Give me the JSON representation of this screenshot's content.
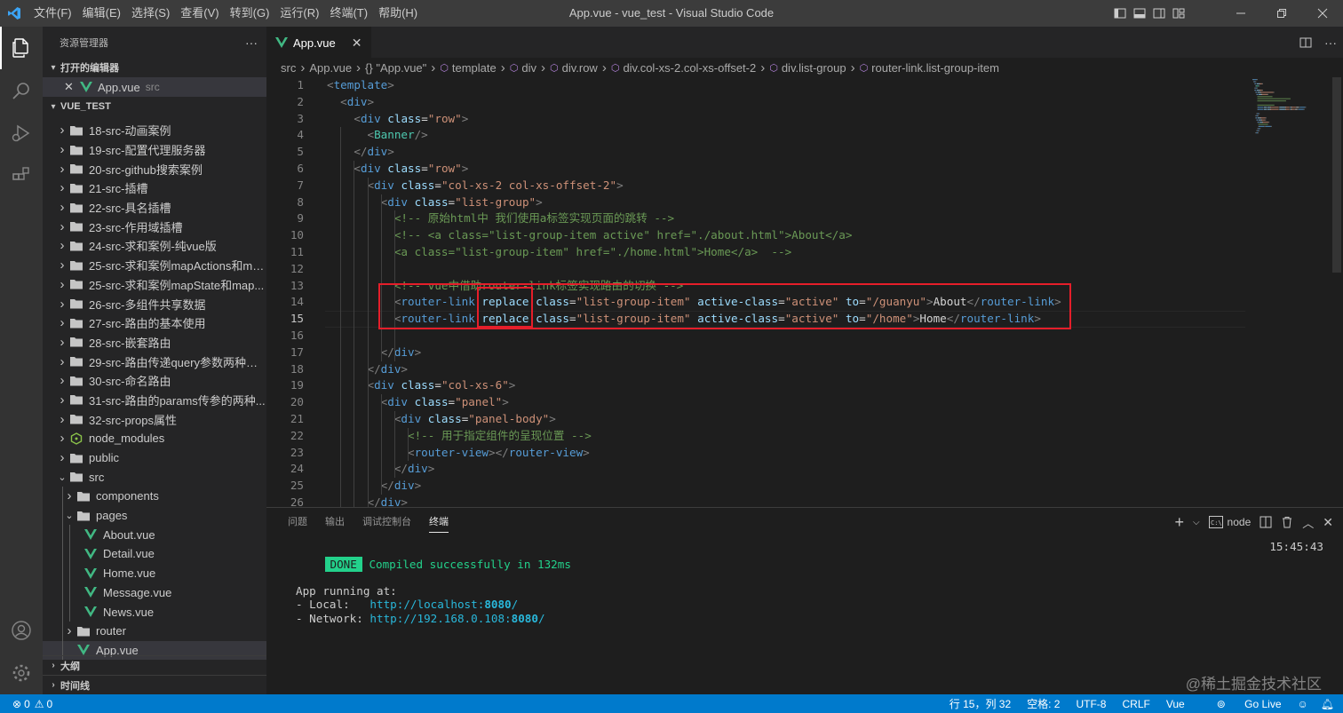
{
  "titlebar": {
    "menus": [
      "文件(F)",
      "编辑(E)",
      "选择(S)",
      "查看(V)",
      "转到(G)",
      "运行(R)",
      "终端(T)",
      "帮助(H)"
    ],
    "title": "App.vue - vue_test - Visual Studio Code"
  },
  "sidebar": {
    "header": "资源管理器",
    "more": "···",
    "open_editors_title": "打开的编辑器",
    "open_editor": {
      "name": "App.vue",
      "dir": "src"
    },
    "workspace_title": "VUE_TEST",
    "tree": [
      {
        "name": "18-src-动画案例",
        "depth": 0,
        "type": "folder",
        "open": false
      },
      {
        "name": "19-src-配置代理服务器",
        "depth": 0,
        "type": "folder",
        "open": false
      },
      {
        "name": "20-src-github搜索案例",
        "depth": 0,
        "type": "folder",
        "open": false
      },
      {
        "name": "21-src-插槽",
        "depth": 0,
        "type": "folder",
        "open": false
      },
      {
        "name": "22-src-具名插槽",
        "depth": 0,
        "type": "folder",
        "open": false
      },
      {
        "name": "23-src-作用域插槽",
        "depth": 0,
        "type": "folder",
        "open": false
      },
      {
        "name": "24-src-求和案例-纯vue版",
        "depth": 0,
        "type": "folder",
        "open": false
      },
      {
        "name": "25-src-求和案例mapActions和ma...",
        "depth": 0,
        "type": "folder",
        "open": false
      },
      {
        "name": "25-src-求和案例mapState和map...",
        "depth": 0,
        "type": "folder",
        "open": false
      },
      {
        "name": "26-src-多组件共享数据",
        "depth": 0,
        "type": "folder",
        "open": false
      },
      {
        "name": "27-src-路由的基本使用",
        "depth": 0,
        "type": "folder",
        "open": false
      },
      {
        "name": "28-src-嵌套路由",
        "depth": 0,
        "type": "folder",
        "open": false
      },
      {
        "name": "29-src-路由传递query参数两种方...",
        "depth": 0,
        "type": "folder",
        "open": false
      },
      {
        "name": "30-src-命名路由",
        "depth": 0,
        "type": "folder",
        "open": false
      },
      {
        "name": "31-src-路由的params传参的两种...",
        "depth": 0,
        "type": "folder",
        "open": false
      },
      {
        "name": "32-src-props属性",
        "depth": 0,
        "type": "folder",
        "open": false
      },
      {
        "name": "node_modules",
        "depth": 0,
        "type": "modules",
        "open": false
      },
      {
        "name": "public",
        "depth": 0,
        "type": "folder",
        "open": false
      },
      {
        "name": "src",
        "depth": 0,
        "type": "folder",
        "open": true
      },
      {
        "name": "components",
        "depth": 1,
        "type": "folder",
        "open": false
      },
      {
        "name": "pages",
        "depth": 1,
        "type": "folder",
        "open": true
      },
      {
        "name": "About.vue",
        "depth": 2,
        "type": "vue"
      },
      {
        "name": "Detail.vue",
        "depth": 2,
        "type": "vue"
      },
      {
        "name": "Home.vue",
        "depth": 2,
        "type": "vue"
      },
      {
        "name": "Message.vue",
        "depth": 2,
        "type": "vue"
      },
      {
        "name": "News.vue",
        "depth": 2,
        "type": "vue"
      },
      {
        "name": "router",
        "depth": 1,
        "type": "folder",
        "open": false
      },
      {
        "name": "App.vue",
        "depth": 1,
        "type": "vue",
        "selected": true
      }
    ],
    "outline_title": "大纲",
    "timeline_title": "时间线"
  },
  "editor": {
    "tab": {
      "name": "App.vue",
      "close": "✕"
    },
    "breadcrumbs": [
      "src",
      "App.vue",
      "{} \"App.vue\"",
      "template",
      "div",
      "div.row",
      "div.col-xs-2.col-xs-offset-2",
      "div.list-group",
      "router-link.list-group-item"
    ],
    "current_line": 15,
    "lines": [
      [
        [
          "b",
          "<"
        ],
        [
          "t",
          "template"
        ],
        [
          "b",
          ">"
        ]
      ],
      [
        [
          "x",
          "  "
        ],
        [
          "b",
          "<"
        ],
        [
          "t",
          "div"
        ],
        [
          "b",
          ">"
        ]
      ],
      [
        [
          "x",
          "    "
        ],
        [
          "b",
          "<"
        ],
        [
          "t",
          "div"
        ],
        [
          "x",
          " "
        ],
        [
          "a",
          "class"
        ],
        [
          "e",
          "="
        ],
        [
          "s",
          "\"row\""
        ],
        [
          "b",
          ">"
        ]
      ],
      [
        [
          "x",
          "      "
        ],
        [
          "b",
          "<"
        ],
        [
          "c",
          "Banner"
        ],
        [
          "b",
          "/>"
        ]
      ],
      [
        [
          "x",
          "    "
        ],
        [
          "b",
          "</"
        ],
        [
          "t",
          "div"
        ],
        [
          "b",
          ">"
        ]
      ],
      [
        [
          "x",
          "    "
        ],
        [
          "b",
          "<"
        ],
        [
          "t",
          "div"
        ],
        [
          "x",
          " "
        ],
        [
          "a",
          "class"
        ],
        [
          "e",
          "="
        ],
        [
          "s",
          "\"row\""
        ],
        [
          "b",
          ">"
        ]
      ],
      [
        [
          "x",
          "      "
        ],
        [
          "b",
          "<"
        ],
        [
          "t",
          "div"
        ],
        [
          "x",
          " "
        ],
        [
          "a",
          "class"
        ],
        [
          "e",
          "="
        ],
        [
          "s",
          "\"col-xs-2 col-xs-offset-2\""
        ],
        [
          "b",
          ">"
        ]
      ],
      [
        [
          "x",
          "        "
        ],
        [
          "b",
          "<"
        ],
        [
          "t",
          "div"
        ],
        [
          "x",
          " "
        ],
        [
          "a",
          "class"
        ],
        [
          "e",
          "="
        ],
        [
          "s",
          "\"list-group\""
        ],
        [
          "b",
          ">"
        ]
      ],
      [
        [
          "x",
          "          "
        ],
        [
          "m",
          "<!-- 原始html中 我们使用a标签实现页面的跳转 -->"
        ]
      ],
      [
        [
          "x",
          "          "
        ],
        [
          "m",
          "<!-- <a class=\"list-group-item active\" href=\"./about.html\">About</a>"
        ]
      ],
      [
        [
          "x",
          "          "
        ],
        [
          "m",
          "<a class=\"list-group-item\" href=\"./home.html\">Home</a>  -->"
        ]
      ],
      [
        [
          "x",
          ""
        ]
      ],
      [
        [
          "x",
          "          "
        ],
        [
          "m",
          "<!-- vue中借助router-link标签实现路由的切换 -->"
        ]
      ],
      [
        [
          "x",
          "          "
        ],
        [
          "b",
          "<"
        ],
        [
          "t",
          "router-link"
        ],
        [
          "x",
          " "
        ],
        [
          "a",
          "replace"
        ],
        [
          "x",
          " "
        ],
        [
          "a",
          "class"
        ],
        [
          "e",
          "="
        ],
        [
          "s",
          "\"list-group-item\""
        ],
        [
          "x",
          " "
        ],
        [
          "a",
          "active-class"
        ],
        [
          "e",
          "="
        ],
        [
          "s",
          "\"active\""
        ],
        [
          "x",
          " "
        ],
        [
          "a",
          "to"
        ],
        [
          "e",
          "="
        ],
        [
          "s",
          "\"/guanyu\""
        ],
        [
          "b",
          ">"
        ],
        [
          "x",
          "About"
        ],
        [
          "b",
          "</"
        ],
        [
          "t",
          "router-link"
        ],
        [
          "b",
          ">"
        ]
      ],
      [
        [
          "x",
          "          "
        ],
        [
          "b",
          "<"
        ],
        [
          "t",
          "router-link"
        ],
        [
          "x",
          " "
        ],
        [
          "a",
          "replace"
        ],
        [
          "x",
          " "
        ],
        [
          "a",
          "class"
        ],
        [
          "e",
          "="
        ],
        [
          "s",
          "\"list-group-item\""
        ],
        [
          "x",
          " "
        ],
        [
          "a",
          "active-class"
        ],
        [
          "e",
          "="
        ],
        [
          "s",
          "\"active\""
        ],
        [
          "x",
          " "
        ],
        [
          "a",
          "to"
        ],
        [
          "e",
          "="
        ],
        [
          "s",
          "\"/home\""
        ],
        [
          "b",
          ">"
        ],
        [
          "x",
          "Home"
        ],
        [
          "b",
          "</"
        ],
        [
          "t",
          "router-link"
        ],
        [
          "b",
          ">"
        ]
      ],
      [
        [
          "x",
          ""
        ]
      ],
      [
        [
          "x",
          "        "
        ],
        [
          "b",
          "</"
        ],
        [
          "t",
          "div"
        ],
        [
          "b",
          ">"
        ]
      ],
      [
        [
          "x",
          "      "
        ],
        [
          "b",
          "</"
        ],
        [
          "t",
          "div"
        ],
        [
          "b",
          ">"
        ]
      ],
      [
        [
          "x",
          "      "
        ],
        [
          "b",
          "<"
        ],
        [
          "t",
          "div"
        ],
        [
          "x",
          " "
        ],
        [
          "a",
          "class"
        ],
        [
          "e",
          "="
        ],
        [
          "s",
          "\"col-xs-6\""
        ],
        [
          "b",
          ">"
        ]
      ],
      [
        [
          "x",
          "        "
        ],
        [
          "b",
          "<"
        ],
        [
          "t",
          "div"
        ],
        [
          "x",
          " "
        ],
        [
          "a",
          "class"
        ],
        [
          "e",
          "="
        ],
        [
          "s",
          "\"panel\""
        ],
        [
          "b",
          ">"
        ]
      ],
      [
        [
          "x",
          "          "
        ],
        [
          "b",
          "<"
        ],
        [
          "t",
          "div"
        ],
        [
          "x",
          " "
        ],
        [
          "a",
          "class"
        ],
        [
          "e",
          "="
        ],
        [
          "s",
          "\"panel-body\""
        ],
        [
          "b",
          ">"
        ]
      ],
      [
        [
          "x",
          "            "
        ],
        [
          "m",
          "<!-- 用于指定组件的呈现位置 -->"
        ]
      ],
      [
        [
          "x",
          "            "
        ],
        [
          "b",
          "<"
        ],
        [
          "t",
          "router-view"
        ],
        [
          "b",
          "></"
        ],
        [
          "t",
          "router-view"
        ],
        [
          "b",
          ">"
        ]
      ],
      [
        [
          "x",
          "          "
        ],
        [
          "b",
          "</"
        ],
        [
          "t",
          "div"
        ],
        [
          "b",
          ">"
        ]
      ],
      [
        [
          "x",
          "        "
        ],
        [
          "b",
          "</"
        ],
        [
          "t",
          "div"
        ],
        [
          "b",
          ">"
        ]
      ],
      [
        [
          "x",
          "      "
        ],
        [
          "b",
          "</"
        ],
        [
          "t",
          "div"
        ],
        [
          "b",
          ">"
        ]
      ]
    ]
  },
  "panel": {
    "tabs": [
      "问题",
      "输出",
      "调试控制台",
      "终端"
    ],
    "active_tab": 3,
    "terminal_name": "node",
    "done_badge": "DONE",
    "compiled_msg": "Compiled successfully in 132ms",
    "time": "15:45:43",
    "running": "App running at:",
    "local_label": "- Local:   ",
    "local_url_pre": "http://localhost:",
    "local_port": "8080",
    "url_suffix": "/",
    "network_label": "- Network: ",
    "network_url_pre": "http://192.168.0.108:",
    "network_port": "8080"
  },
  "statusbar": {
    "errors": "0",
    "warnings": "0",
    "position": "行 15，列 32",
    "spaces": "空格: 2",
    "encoding": "UTF-8",
    "eol": "CRLF",
    "language": "Vue",
    "golive": "Go Live"
  },
  "watermark": "@稀土掘金技术社区",
  "colors": {
    "accent": "#007acc",
    "highlight_box": "#e51e2a",
    "vue_icon": "#41b883",
    "done_badge": "#23d18b"
  }
}
